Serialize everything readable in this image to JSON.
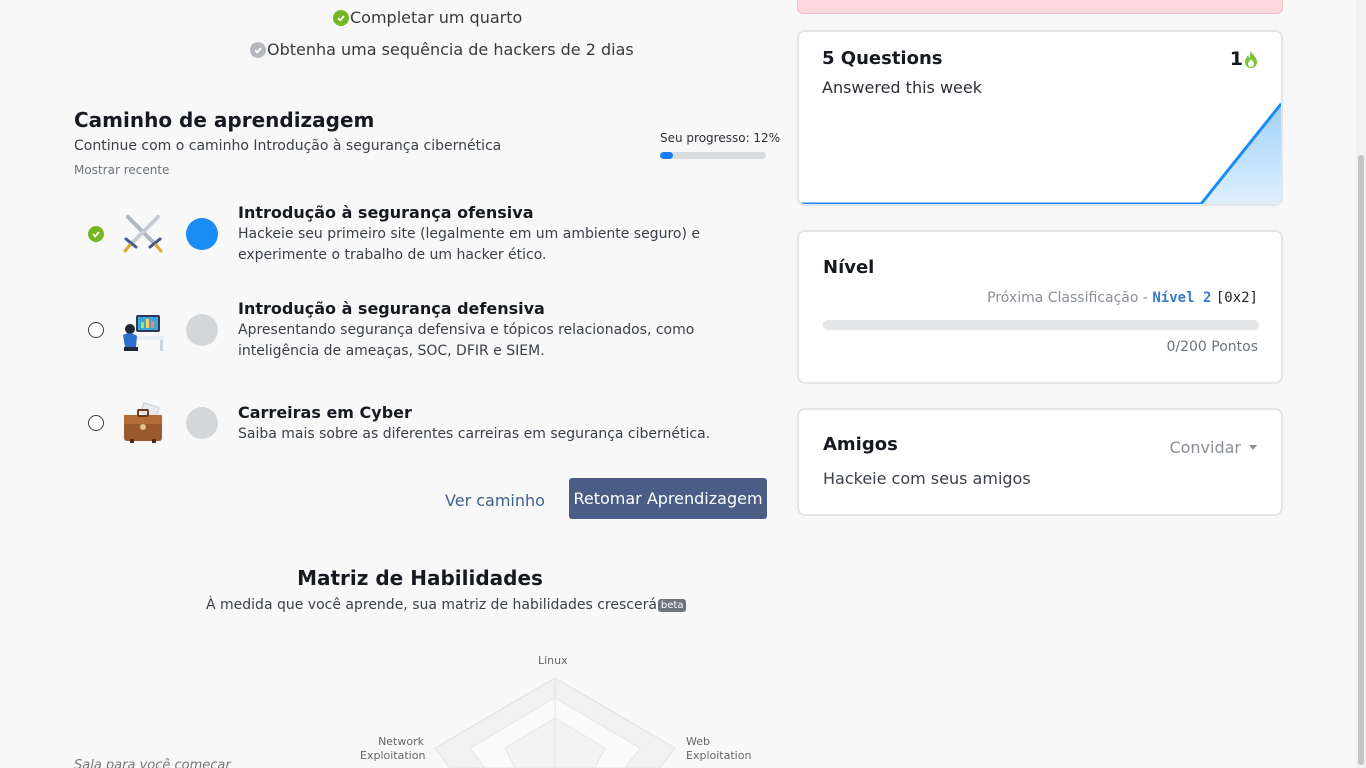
{
  "achievements": [
    {
      "label": "Completar um quarto",
      "done": true
    },
    {
      "label": "Obtenha uma sequência de hackers de 2 dias",
      "done": false
    }
  ],
  "learning_path": {
    "title": "Caminho de aprendizagem",
    "subtitle": "Continue com o caminho Introdução à segurança cibernética",
    "show_recent": "Mostrar recente",
    "progress_label": "Seu progresso: 12%",
    "progress": 0.12,
    "modules": [
      {
        "title": "Introdução à segurança ofensiva",
        "description": "Hackeie seu primeiro site (legalmente em um ambiente seguro) e experimente o trabalho de um hacker ético.",
        "completed": true,
        "icon": "crossed-swords-icon"
      },
      {
        "title": "Introdução à segurança defensiva",
        "description": "Apresentando segurança defensiva e tópicos relacionados, como inteligência de ameaças, SOC, DFIR e SIEM.",
        "completed": false,
        "icon": "analyst-desk-icon"
      },
      {
        "title": "Carreiras em Cyber",
        "description": "Saiba mais sobre as diferentes carreiras em segurança cibernética.",
        "completed": false,
        "icon": "briefcase-icon"
      }
    ],
    "view_path_label": "Ver caminho",
    "resume_label": "Retomar Aprendizagem"
  },
  "skills": {
    "title": "Matriz de Habilidades",
    "subtitle": "À medida que você aprende, sua matriz de habilidades crescerá",
    "badge": "beta",
    "axes": [
      "Linux",
      "Web Exploitation",
      "Network Exploitation"
    ],
    "cut_text": "Sala para você começar"
  },
  "questions_card": {
    "title": "5 Questions",
    "subtitle": "Answered this week",
    "streak": "1",
    "streak_icon": "flame-icon"
  },
  "level_card": {
    "title": "Nível",
    "next_rank_prefix": "Próxima Classificação - ",
    "next_level": "Nível 2",
    "next_level_hex": "[0x2]",
    "points": "0/200 Pontos",
    "progress": 0
  },
  "friends_card": {
    "title": "Amigos",
    "invite_label": "Convidar",
    "subtitle": "Hackeie com seus amigos"
  },
  "colors": {
    "accent": "#1a8cf5",
    "success": "#75b722",
    "button": "#4a5e85"
  }
}
